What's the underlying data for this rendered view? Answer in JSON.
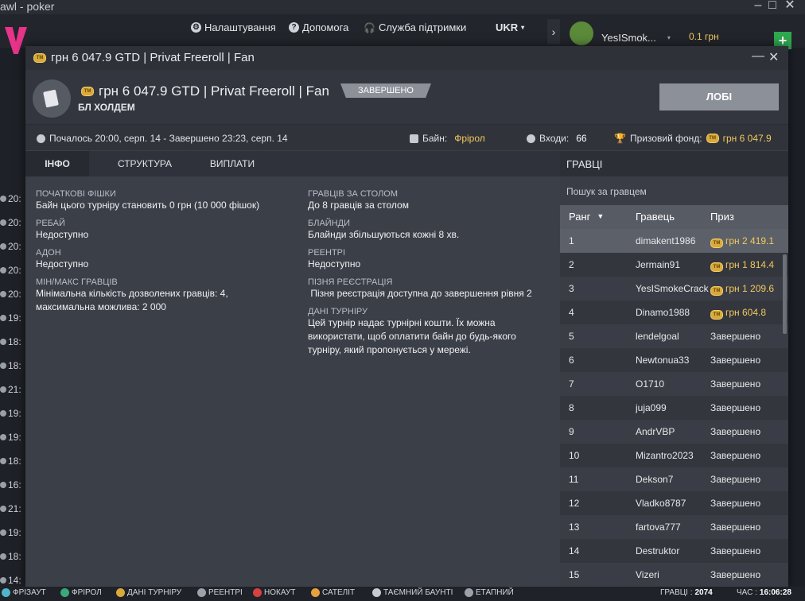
{
  "app": {
    "title": "awl - poker",
    "nav": {
      "settings": "Налаштування",
      "help": "Допомога",
      "support": "Служба підтримки",
      "language": "UKR",
      "username": "YesISmok...",
      "balance": "0.1 грн"
    },
    "side_times": [
      "20:",
      "20:",
      "20:",
      "20:",
      "20:",
      "19:",
      "18:",
      "18:",
      "21:",
      "19:",
      "19:",
      "18:",
      "16:",
      "21:",
      "19:",
      "18:",
      "14:"
    ]
  },
  "modal": {
    "window_title": "грн 6 047.9 GTD | Privat Freeroll | Fan",
    "title": "грн 6 047.9 GTD | Privat Freeroll | Fan",
    "subtitle": "БЛ ХОЛДЕМ",
    "status": "ЗАВЕРШЕНО",
    "lobby_button": "ЛОБІ",
    "meta": {
      "time": "Почалось 20:00, серп. 14  -  Завершено 23:23, серп. 14",
      "buyin_label": "Байн:",
      "buyin_value": "Фрірол",
      "entries_label": "Входи:",
      "entries_value": "66",
      "prize_label": "Призовий фонд:",
      "prize_value": "грн 6 047.9"
    },
    "tabs": [
      "ІНФО",
      "СТРУКТУРА",
      "ВИПЛАТИ"
    ],
    "info_left": [
      {
        "label": "ПОЧАТКОВІ ФІШКИ",
        "value": "Байн цього турніру становить 0 грн (10 000 фішок)"
      },
      {
        "label": "РЕБАЙ",
        "value": "Недоступно"
      },
      {
        "label": "АДОН",
        "value": "Недоступно"
      },
      {
        "label": "МІН/МАКС ГРАВЦІВ",
        "value": "Мінімальна кількість дозволених гравців: 4, максимальна можлива: 2 000"
      }
    ],
    "info_right": [
      {
        "label": "ГРАВЦІВ ЗА СТОЛОМ",
        "value": "До 8 гравців за столом"
      },
      {
        "label": "БЛАЙНДИ",
        "value": "Блайнди збільшуються кожні 8 хв."
      },
      {
        "label": "РЕЕНТРІ",
        "value": "Недоступно"
      },
      {
        "label": "ПІЗНЯ РЕЄСТРАЦІЯ",
        "value": " Пізня реєстрація доступна до завершення рівня 2"
      },
      {
        "label": "ДАНІ ТУРНІРУ",
        "value": "Цей турнір надає турнірні кошти. Їх можна використати, щоб оплатити байн до будь-якого турніру, який пропонується у мережі."
      }
    ],
    "players": {
      "header": "ГРАВЦІ",
      "search_placeholder": "Пошук за гравцем",
      "columns": {
        "rank": "Ранг",
        "player": "Гравець",
        "prize": "Приз"
      },
      "rows": [
        {
          "rank": "1",
          "name": "dimakent1986",
          "prize": "грн 2 419.1",
          "money": true
        },
        {
          "rank": "2",
          "name": "Jermain91",
          "prize": "грн 1 814.4",
          "money": true
        },
        {
          "rank": "3",
          "name": "YesISmokeCrack",
          "prize": "грн 1 209.6",
          "money": true
        },
        {
          "rank": "4",
          "name": "Dinamo1988",
          "prize": "грн 604.8",
          "money": true
        },
        {
          "rank": "5",
          "name": "lendelgoal",
          "prize": "Завершено",
          "money": false
        },
        {
          "rank": "6",
          "name": "Newtonua33",
          "prize": "Завершено",
          "money": false
        },
        {
          "rank": "7",
          "name": "O1710",
          "prize": "Завершено",
          "money": false
        },
        {
          "rank": "8",
          "name": "juja099",
          "prize": "Завершено",
          "money": false
        },
        {
          "rank": "9",
          "name": "AndrVBP",
          "prize": "Завершено",
          "money": false
        },
        {
          "rank": "10",
          "name": "Mizantro2023",
          "prize": "Завершено",
          "money": false
        },
        {
          "rank": "11",
          "name": "Dekson7",
          "prize": "Завершено",
          "money": false
        },
        {
          "rank": "12",
          "name": "Vladko8787",
          "prize": "Завершено",
          "money": false
        },
        {
          "rank": "13",
          "name": "fartova777",
          "prize": "Завершено",
          "money": false
        },
        {
          "rank": "14",
          "name": "Destruktor",
          "prize": "Завершено",
          "money": false
        },
        {
          "rank": "15",
          "name": "Vizeri",
          "prize": "Завершено",
          "money": false
        }
      ]
    }
  },
  "bottom_bar": {
    "legend": [
      "ФРІЗАУТ",
      "ФРІРОЛ",
      "ДАНІ ТУРНІРУ",
      "РЕЕНТРІ",
      "НОКАУТ",
      "САТЕЛІТ",
      "ТАЄМНИЙ БАУНТІ",
      "ЕТАПНИЙ"
    ],
    "players_label": "ГРАВЦІ :",
    "players_value": "2074",
    "clock_label": "ЧАС :",
    "clock_value": "16:06:28"
  },
  "colors": {
    "accent_gold": "#f3c860",
    "logo_pink": "#e8338a",
    "lobby_button": "#8c9099",
    "active_tab": "#272a30"
  }
}
